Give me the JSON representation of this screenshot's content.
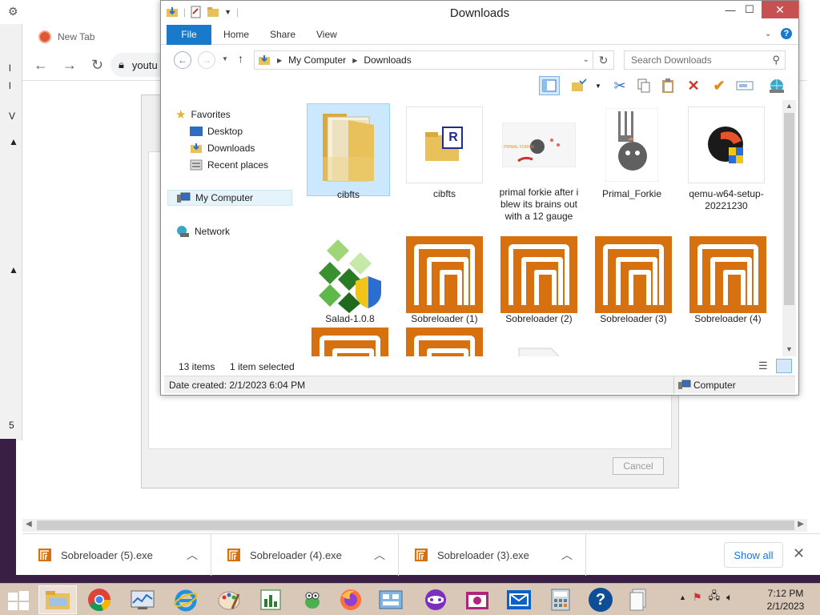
{
  "browser": {
    "tab_title": "New Tab",
    "url_text": "youtu",
    "gutter_chars": [
      "l",
      "l",
      "V",
      "▲",
      "▲",
      "5"
    ]
  },
  "dialog": {
    "cancel_label": "Cancel"
  },
  "explorer": {
    "window_title": "Downloads",
    "ribbon_tabs": [
      "File",
      "Home",
      "Share",
      "View"
    ],
    "address": {
      "root": "My Computer",
      "folder": "Downloads"
    },
    "search_placeholder": "Search Downloads",
    "nav": {
      "favorites": "Favorites",
      "desktop": "Desktop",
      "downloads": "Downloads",
      "recent": "Recent places",
      "computer": "My Computer",
      "network": "Network"
    },
    "files": [
      {
        "name": "cibfts",
        "kind": "folder"
      },
      {
        "name": "cibfts",
        "kind": "r-file"
      },
      {
        "name": "primal forkie after i blew its brains out with a 12 gauge",
        "kind": "image"
      },
      {
        "name": "Primal_Forkie",
        "kind": "image"
      },
      {
        "name": "qemu-w64-setup-20221230",
        "kind": "installer"
      },
      {
        "name": "Salad-1.0.8",
        "kind": "installer"
      },
      {
        "name": "Sobreloader (1)",
        "kind": "sobreloader"
      },
      {
        "name": "Sobreloader (2)",
        "kind": "sobreloader"
      },
      {
        "name": "Sobreloader (3)",
        "kind": "sobreloader"
      },
      {
        "name": "Sobreloader (4)",
        "kind": "sobreloader"
      }
    ],
    "thumb_caption": "PRIMAL FORKIE",
    "status": {
      "items": "13 items",
      "selected": "1 item selected"
    },
    "details": {
      "date_created": "Date created: 2/1/2023 6:04 PM",
      "location": "Computer"
    }
  },
  "downloads_shelf": {
    "items": [
      {
        "name": "Sobreloader (5).exe"
      },
      {
        "name": "Sobreloader (4).exe"
      },
      {
        "name": "Sobreloader (3).exe"
      }
    ],
    "show_all": "Show all"
  },
  "taskbar": {
    "clock_time": "7:12 PM",
    "clock_date": "2/1/2023"
  },
  "colors": {
    "file_tab": "#1979ca",
    "selection": "#cce8ff",
    "sobreloader_orange": "#d7700e",
    "taskbar": "#d9c7b8"
  }
}
